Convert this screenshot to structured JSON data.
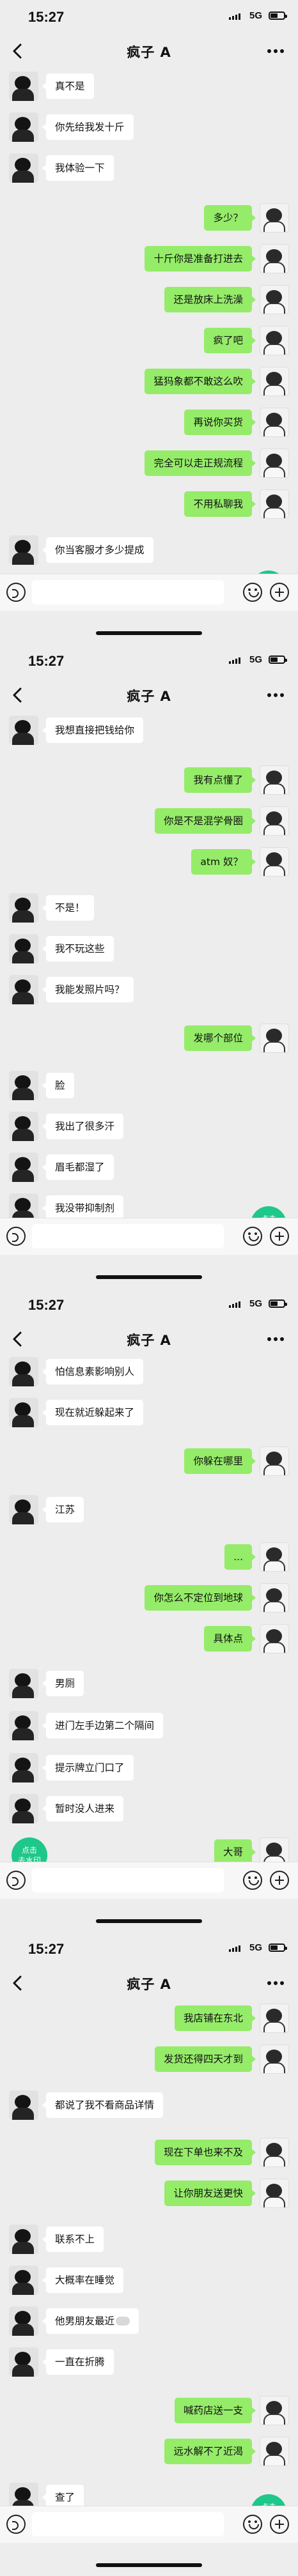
{
  "status_time": "15:27",
  "network": "5G",
  "chat_title": "疯子 A",
  "watermark": {
    "line1": "点击",
    "line2": "去水印"
  },
  "screens": [
    {
      "messages": [
        {
          "side": "in",
          "text": "真不是"
        },
        {
          "side": "in",
          "text": "你先给我发十斤"
        },
        {
          "side": "in",
          "text": "我体验一下"
        },
        {
          "side": "out",
          "text": "多少？"
        },
        {
          "side": "out",
          "text": "十斤你是准备打进去"
        },
        {
          "side": "out",
          "text": "还是放床上洗澡"
        },
        {
          "side": "out",
          "text": "疯了吧"
        },
        {
          "side": "out",
          "text": "猛犸象都不敢这么吹"
        },
        {
          "side": "out",
          "text": "再说你买货"
        },
        {
          "side": "out",
          "text": "完全可以走正规流程"
        },
        {
          "side": "out",
          "text": "不用私聊我"
        },
        {
          "side": "in",
          "text": "你当客服才多少提成"
        }
      ]
    },
    {
      "messages": [
        {
          "side": "in",
          "text": "我想直接把钱给你"
        },
        {
          "side": "out",
          "text": "我有点懂了"
        },
        {
          "side": "out",
          "text": "你是不是混学骨圈"
        },
        {
          "side": "out",
          "text": "atm 奴？"
        },
        {
          "side": "in",
          "text": "不是！"
        },
        {
          "side": "in",
          "text": "我不玩这些"
        },
        {
          "side": "in",
          "text": "我能发照片吗？"
        },
        {
          "side": "out",
          "text": "发哪个部位"
        },
        {
          "side": "in",
          "text": "脸"
        },
        {
          "side": "in",
          "text": "我出了很多汗"
        },
        {
          "side": "in",
          "text": "眉毛都湿了"
        },
        {
          "side": "in",
          "text": "我没带抑制剂"
        }
      ]
    },
    {
      "messages": [
        {
          "side": "in",
          "text": "怕信息素影响别人"
        },
        {
          "side": "in",
          "text": "现在就近躲起来了"
        },
        {
          "side": "out",
          "text": "你躲在哪里"
        },
        {
          "side": "in",
          "text": "江苏"
        },
        {
          "side": "out",
          "text": "..."
        },
        {
          "side": "out",
          "text": "你怎么不定位到地球"
        },
        {
          "side": "out",
          "text": "具体点"
        },
        {
          "side": "in",
          "text": "男厕"
        },
        {
          "side": "in",
          "text": "进门左手边第二个隔间"
        },
        {
          "side": "in",
          "text": "提示牌立门口了"
        },
        {
          "side": "in",
          "text": "暂时没人进来"
        },
        {
          "side": "out",
          "text": "大哥"
        }
      ]
    },
    {
      "messages": [
        {
          "side": "out",
          "text": "我店铺在东北"
        },
        {
          "side": "out",
          "text": "发货还得四天才到"
        },
        {
          "side": "in",
          "text": "都说了我不看商品详情"
        },
        {
          "side": "out",
          "text": "现在下单也来不及"
        },
        {
          "side": "out",
          "text": "让你朋友送更快"
        },
        {
          "side": "in",
          "text": "联系不上"
        },
        {
          "side": "in",
          "text": "大概率在睡觉"
        },
        {
          "side": "in",
          "text": "他男朋友最近",
          "blur": true
        },
        {
          "side": "in",
          "text": "一直在折腾"
        },
        {
          "side": "out",
          "text": "喊药店送一支"
        },
        {
          "side": "out",
          "text": "远水解不了近渴"
        },
        {
          "side": "in",
          "text": "查了"
        }
      ]
    }
  ],
  "colors": {
    "incoming": "#ffffff",
    "outgoing": "#95ec69",
    "background": "#ededed",
    "watermark": "#1ec78a"
  }
}
